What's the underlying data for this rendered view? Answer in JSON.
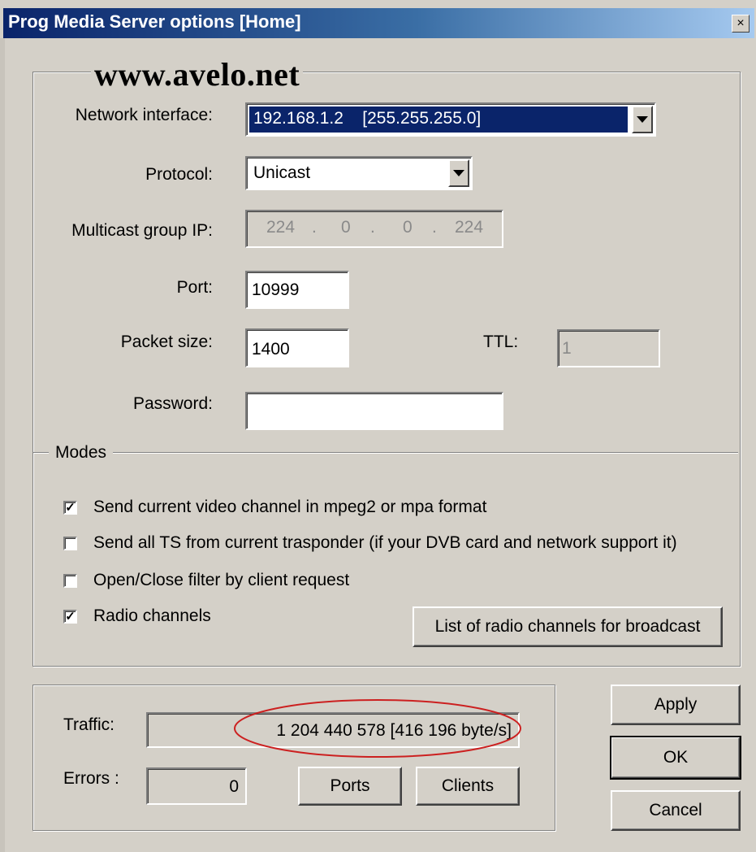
{
  "window": {
    "title": "Prog Media Server options [Home]",
    "close_glyph": "×",
    "watermark": "www.avelo.net"
  },
  "network": {
    "interface_label": "Network interface:",
    "interface_value": "192.168.1.2    [255.255.255.0]",
    "protocol_label": "Protocol:",
    "protocol_value": "Unicast",
    "multicast_label": "Multicast group IP:",
    "multicast_octets": [
      "224",
      "0",
      "0",
      "224"
    ],
    "port_label": "Port:",
    "port_value": "10999",
    "packet_label": "Packet size:",
    "packet_value": "1400",
    "ttl_label": "TTL:",
    "ttl_value": "1",
    "password_label": "Password:",
    "password_value": ""
  },
  "modes": {
    "title": "Modes",
    "items": [
      {
        "label": "Send current video channel in mpeg2 or mpa format",
        "checked": true
      },
      {
        "label": "Send all TS from current trasponder (if your DVB card and network support it)",
        "checked": false
      },
      {
        "label": "Open/Close filter by client request",
        "checked": false
      },
      {
        "label": "Radio channels",
        "checked": true
      }
    ],
    "radio_list_button": "List of radio channels for broadcast"
  },
  "stats": {
    "traffic_label": "Traffic:",
    "traffic_value": "1 204 440 578  [416 196 byte/s]",
    "errors_label": "Errors :",
    "errors_value": "0",
    "ports_button": "Ports",
    "clients_button": "Clients"
  },
  "actions": {
    "apply": "Apply",
    "ok": "OK",
    "cancel": "Cancel"
  },
  "colors": {
    "titlebar": "#0a246a",
    "highlight": "#0a246a",
    "annotation": "#cc2020",
    "face": "#d4d0c8"
  }
}
